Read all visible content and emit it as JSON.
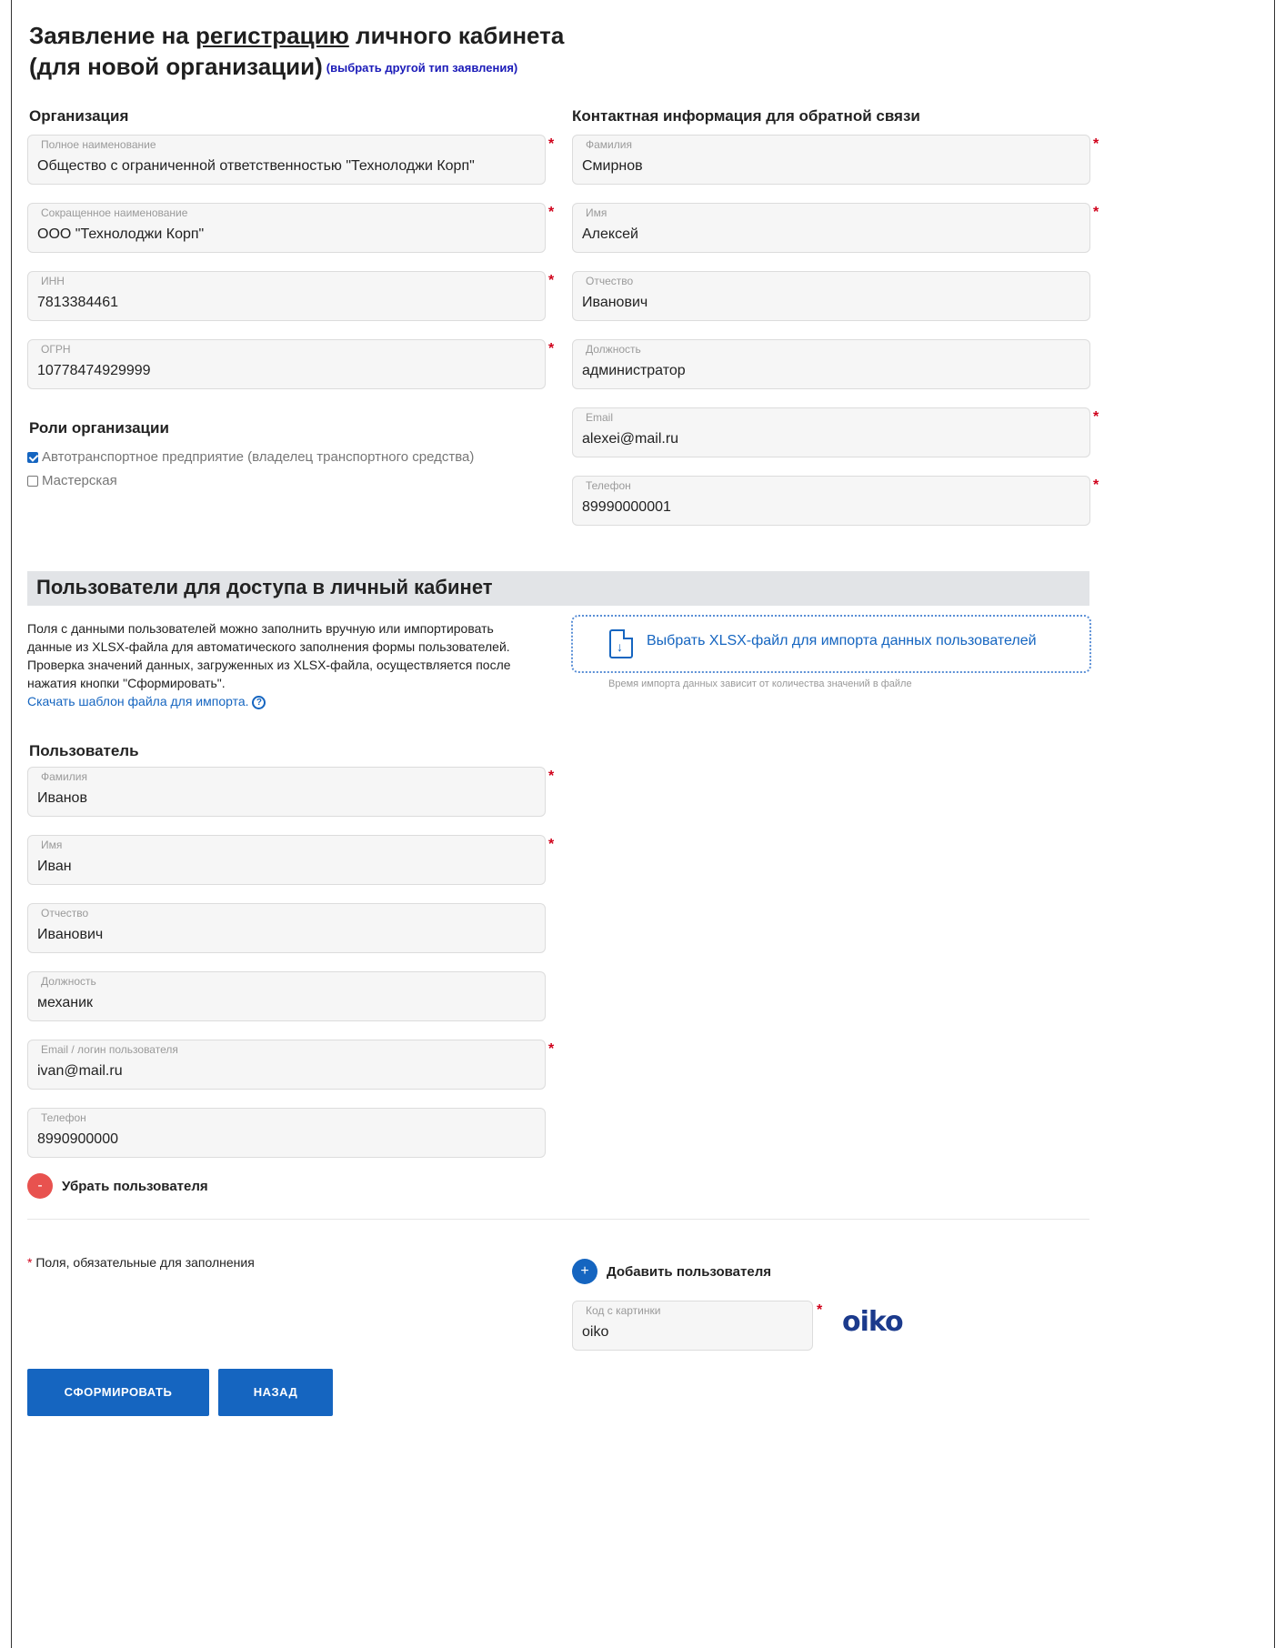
{
  "header": {
    "title_part1": "Заявление на ",
    "title_link": "регистрацию",
    "title_part2": " личного кабинета",
    "title_line2": "(для новой организации)",
    "alt_link": "(выбрать другой тип заявления)"
  },
  "organization": {
    "heading": "Организация",
    "fields": [
      {
        "label": "Полное наименование",
        "value": "Общество с ограниченной ответственностью \"Технолоджи Корп\"",
        "required": true
      },
      {
        "label": "Сокращенное наименование",
        "value": "ООО \"Технолоджи Корп\"",
        "required": true
      },
      {
        "label": "ИНН",
        "value": "7813384461",
        "required": true
      },
      {
        "label": "ОГРН",
        "value": "10778474929999",
        "required": true
      }
    ]
  },
  "roles": {
    "heading": "Роли организации",
    "options": [
      {
        "label": "Автотранспортное предприятие (владелец транспортного средства)",
        "checked": true
      },
      {
        "label": "Мастерская",
        "checked": false
      }
    ]
  },
  "contact": {
    "heading": "Контактная информация для обратной связи",
    "fields": [
      {
        "label": "Фамилия",
        "value": "Смирнов",
        "required": true
      },
      {
        "label": "Имя",
        "value": "Алексей",
        "required": true
      },
      {
        "label": "Отчество",
        "value": "Иванович",
        "required": false
      },
      {
        "label": "Должность",
        "value": "администратор",
        "required": false
      },
      {
        "label": "Email",
        "value": "alexei@mail.ru",
        "required": true
      },
      {
        "label": "Телефон",
        "value": "89990000001",
        "required": true
      }
    ]
  },
  "users_section": {
    "title": "Пользователи для доступа в личный кабинет",
    "info_lines": [
      "Поля с данными пользователей можно заполнить вручную или импортировать",
      "данные из XLSX-файла для автоматического заполнения формы пользователей.",
      "Проверка значений данных, загруженных из XLSX-файла, осуществляется после",
      "нажатия кнопки \"Сформировать\"."
    ],
    "template_link": "Скачать шаблон файла для импорта.",
    "help_glyph": "?",
    "import_label": "Выбрать XLSX-файл для импорта данных пользователей",
    "import_note": "Время импорта данных зависит от количества значений в файле"
  },
  "user": {
    "heading": "Пользователь",
    "fields": [
      {
        "label": "Фамилия",
        "value": "Иванов",
        "required": true
      },
      {
        "label": "Имя",
        "value": "Иван",
        "required": true
      },
      {
        "label": "Отчество",
        "value": "Иванович",
        "required": false
      },
      {
        "label": "Должность",
        "value": "механик",
        "required": false
      },
      {
        "label": "Email / логин пользователя",
        "value": "ivan@mail.ru",
        "required": true
      },
      {
        "label": "Телефон",
        "value": "8990900000",
        "required": false
      }
    ],
    "remove_glyph": "-",
    "remove_label": "Убрать пользователя"
  },
  "footer": {
    "required_star": "*",
    "required_note": " Поля, обязательные для заполнения",
    "add_glyph": "+",
    "add_label": "Добавить пользователя",
    "captcha_label": "Код с картинки",
    "captcha_value": "oiko",
    "captcha_image_text": "oiko",
    "submit_label": "СФОРМИРОВАТЬ",
    "back_label": "НАЗАД"
  },
  "colors": {
    "accent": "#1565c0",
    "required": "#d0021b",
    "remove": "#e8524f",
    "band": "#e2e4e7"
  }
}
